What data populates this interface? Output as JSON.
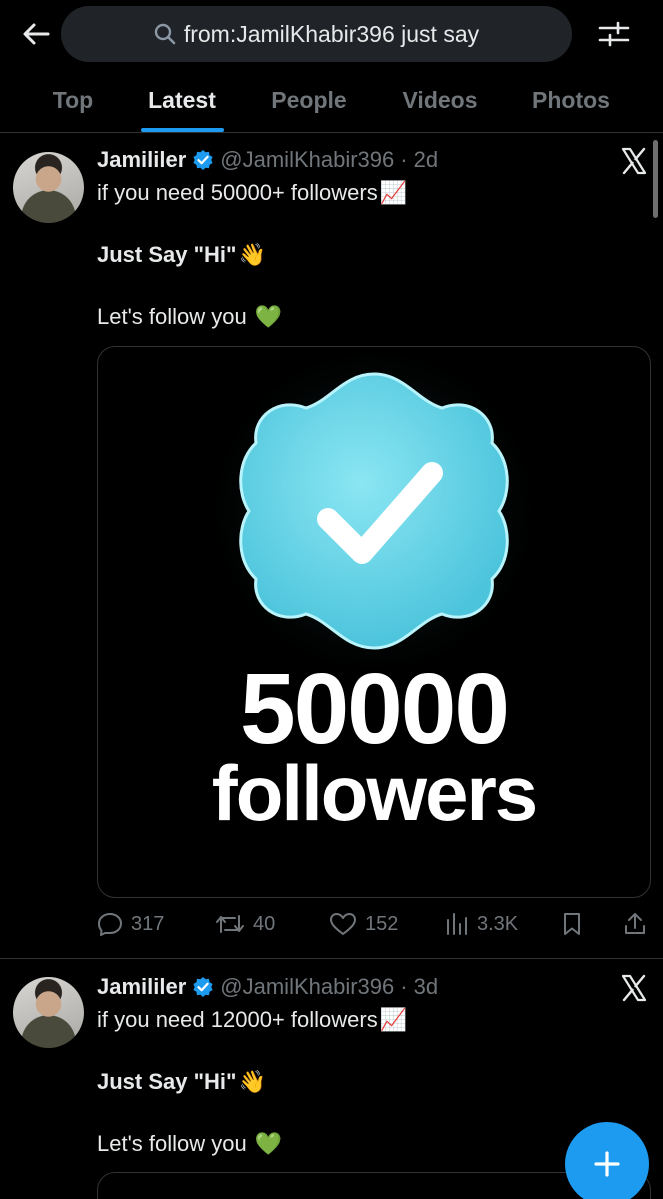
{
  "search": {
    "query": "from:JamilKhabir396 just say"
  },
  "tabs": [
    {
      "label": "Top"
    },
    {
      "label": "Latest"
    },
    {
      "label": "People"
    },
    {
      "label": "Videos"
    },
    {
      "label": "Photos"
    }
  ],
  "active_tab": "Latest",
  "colors": {
    "accent": "#1d9bf0",
    "background": "#000000",
    "muted": "#71767b"
  },
  "tweets": [
    {
      "author": "Jamililer",
      "handle": "@JamilKhabir396",
      "time": "2d",
      "line1": "if you need 50000+ followers",
      "line1_emoji": "📈",
      "line2": "Just Say \"Hi\"",
      "line2_emoji": "👋",
      "line3": "Let's follow you",
      "line3_emoji": "💚",
      "media": {
        "big_number": "50000",
        "big_word": "followers"
      },
      "stats": {
        "replies": "317",
        "reposts": "40",
        "likes": "152",
        "views": "3.3K"
      }
    },
    {
      "author": "Jamililer",
      "handle": "@JamilKhabir396",
      "time": "3d",
      "line1": "if you need 12000+ followers",
      "line1_emoji": "📈",
      "line2": "Just Say \"Hi\"",
      "line2_emoji": "👋",
      "line3": "Let's follow you",
      "line3_emoji": "💚"
    }
  ]
}
